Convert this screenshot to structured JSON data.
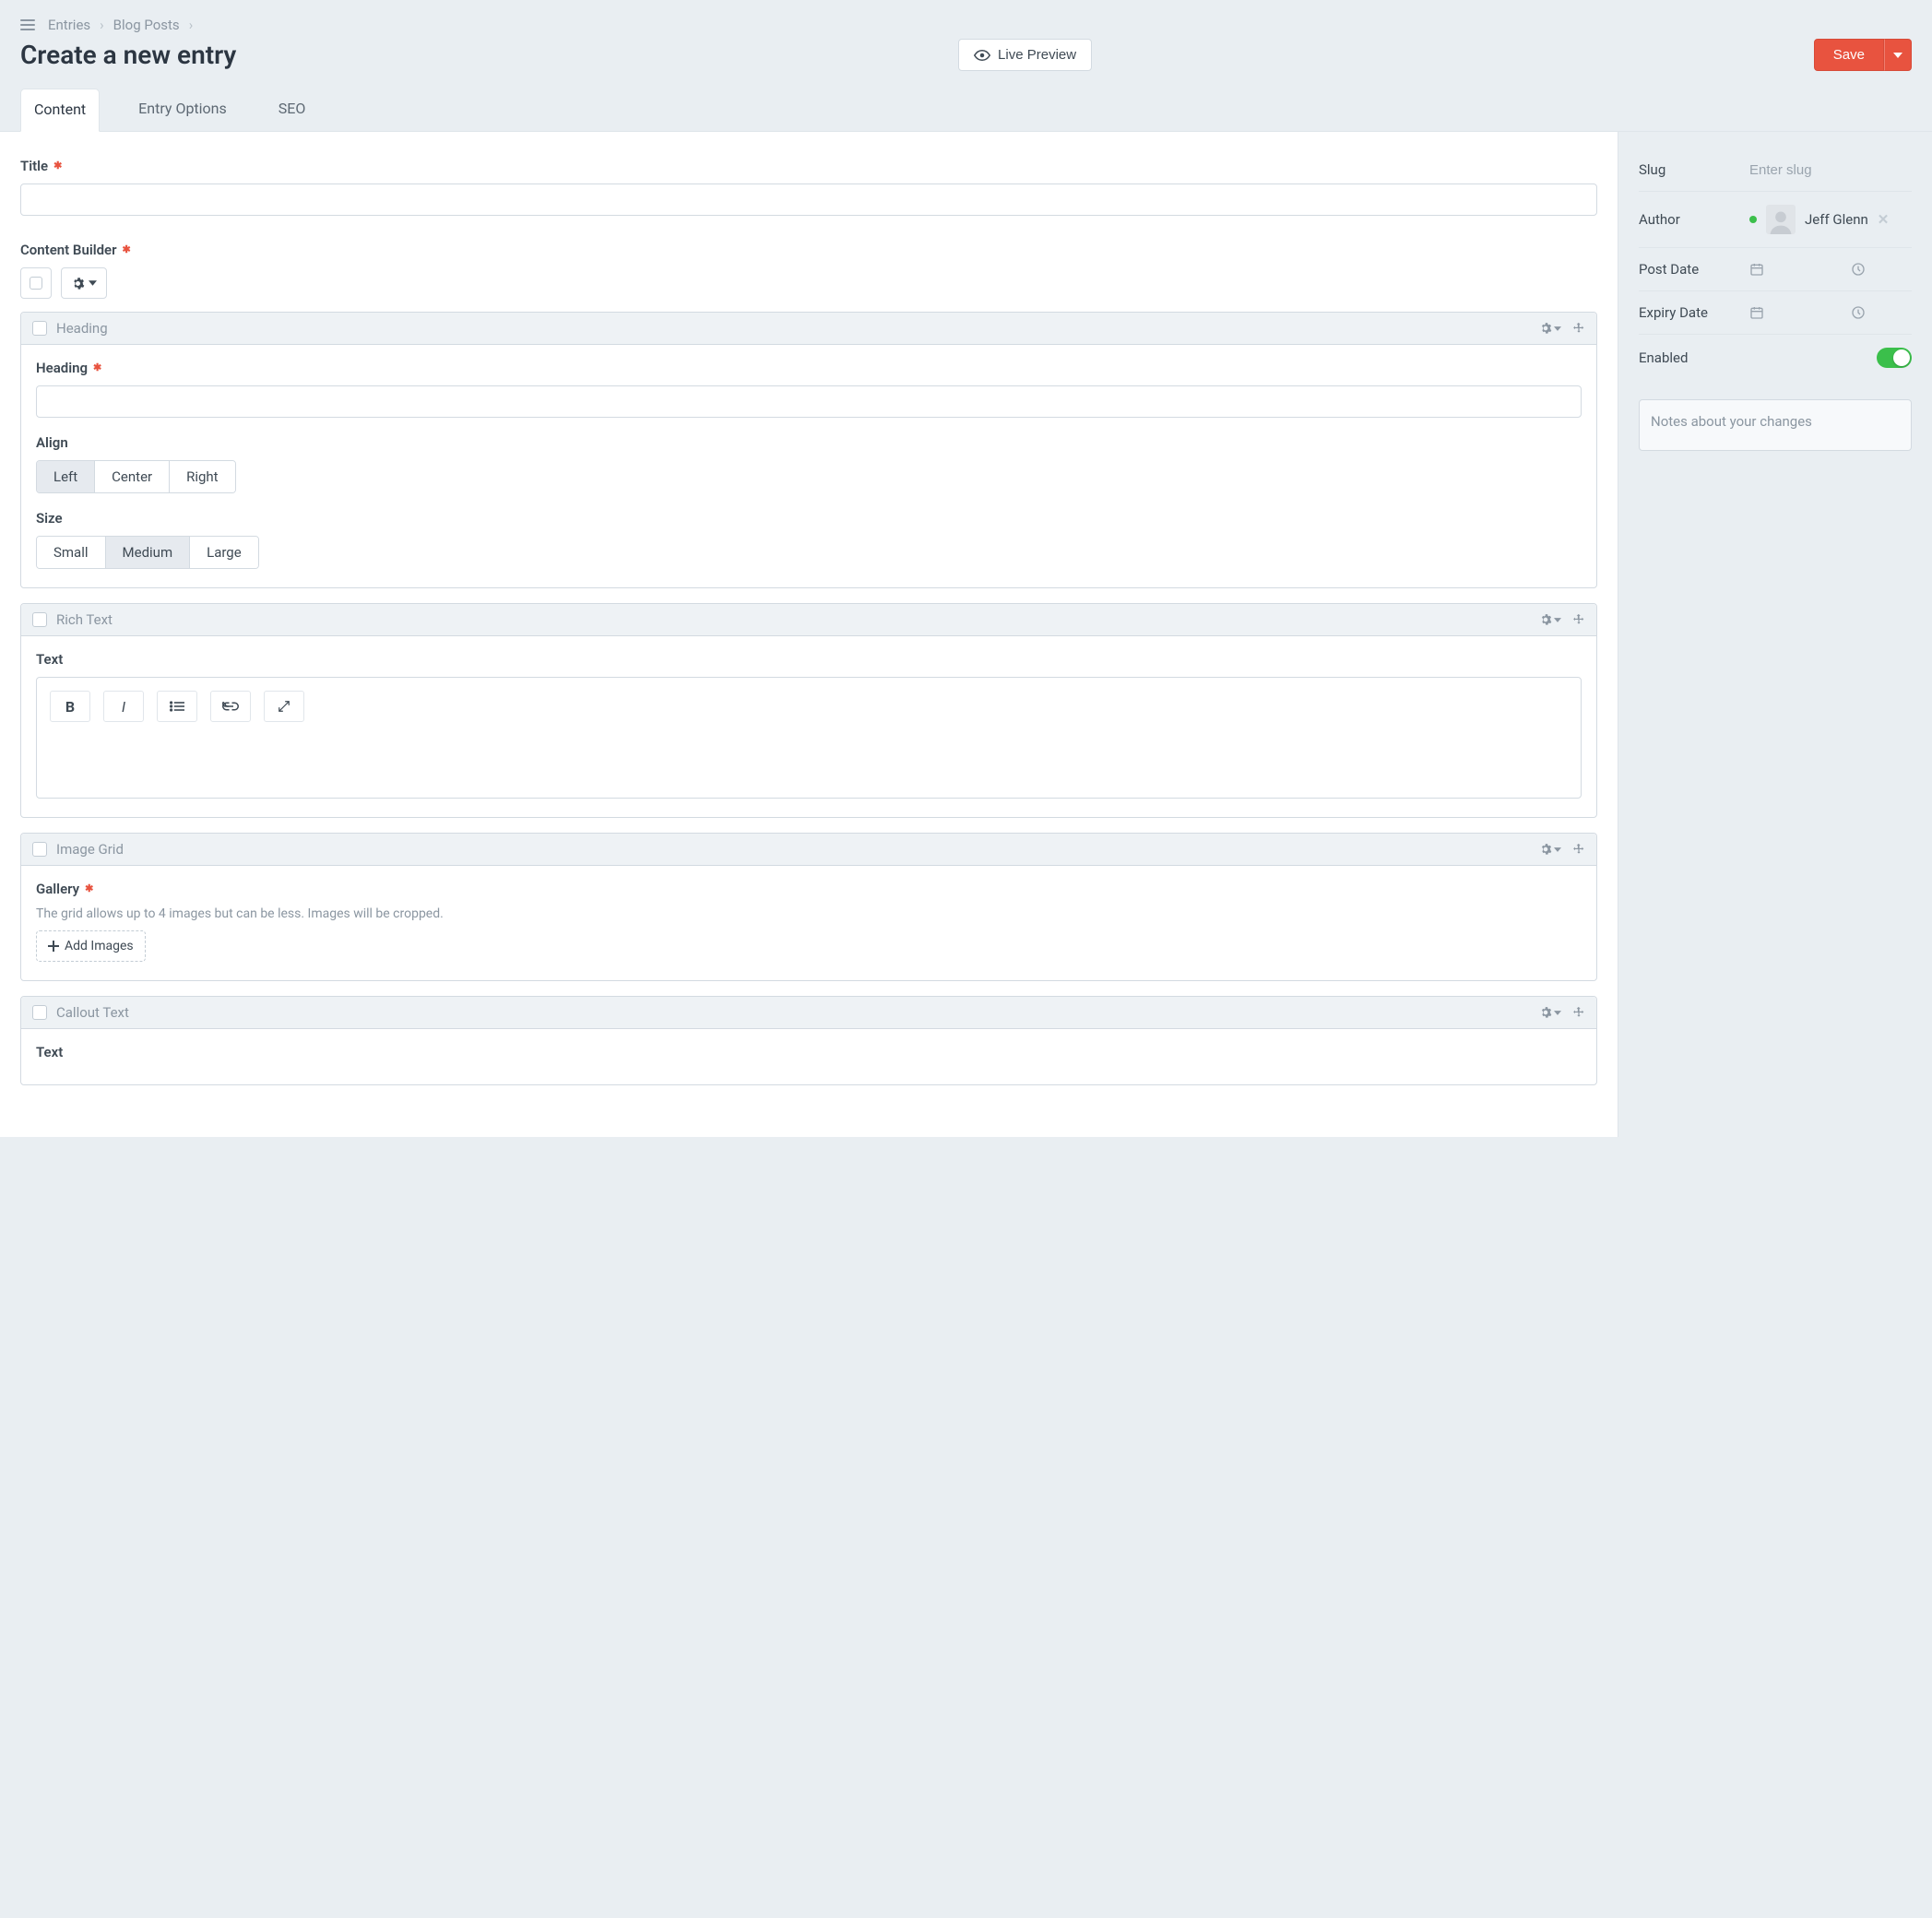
{
  "breadcrumb": {
    "entries": "Entries",
    "blogposts": "Blog Posts"
  },
  "page_title": "Create a new entry",
  "buttons": {
    "live_preview": "Live Preview",
    "save": "Save"
  },
  "tabs": {
    "content": "Content",
    "entry_options": "Entry Options",
    "seo": "SEO"
  },
  "fields": {
    "title_label": "Title",
    "builder_label": "Content Builder"
  },
  "blocks": {
    "heading": {
      "name": "Heading",
      "heading_label": "Heading",
      "align_label": "Align",
      "align_options": {
        "left": "Left",
        "center": "Center",
        "right": "Right"
      },
      "align_selected": "left",
      "size_label": "Size",
      "size_options": {
        "small": "Small",
        "medium": "Medium",
        "large": "Large"
      },
      "size_selected": "medium"
    },
    "richtext": {
      "name": "Rich Text",
      "text_label": "Text"
    },
    "imagegrid": {
      "name": "Image Grid",
      "gallery_label": "Gallery",
      "gallery_help": "The grid allows up to 4 images but can be less. Images will be cropped.",
      "add_images": "Add Images"
    },
    "callout": {
      "name": "Callout Text",
      "text_label": "Text"
    }
  },
  "sidebar": {
    "slug_label": "Slug",
    "slug_placeholder": "Enter slug",
    "author_label": "Author",
    "author_name": "Jeff Glenn",
    "postdate_label": "Post Date",
    "expiry_label": "Expiry Date",
    "enabled_label": "Enabled",
    "enabled": true,
    "notes_placeholder": "Notes about your changes"
  }
}
